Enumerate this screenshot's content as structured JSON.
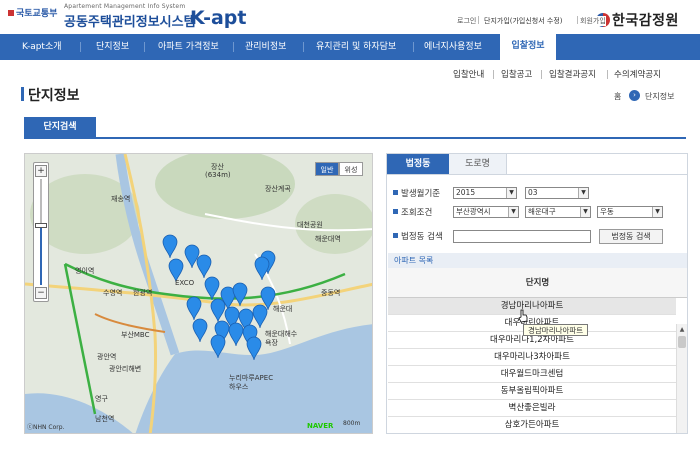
{
  "header": {
    "ministry": "국토교통부",
    "subtitle": "Apartement Management Info System",
    "title": "공동주택관리정보시스템",
    "brand": "K-apt",
    "util_links": [
      "로그인",
      "단지가입(가입신청서 수정)",
      "회원가입"
    ],
    "agency": "한국감정원"
  },
  "gnb": {
    "items": [
      "K-apt소개",
      "단지정보",
      "아파트 가격정보",
      "관리비정보",
      "유지관리 및 하자담보",
      "에너지사용정보"
    ],
    "active": "입찰정보"
  },
  "subnav": [
    "입찰안내",
    "입찰공고",
    "입찰결과공지",
    "수의계약공지"
  ],
  "page": {
    "title": "단지정보",
    "breadcrumb_home": "홈",
    "breadcrumb_current": "단지정보",
    "tab": "단지검색"
  },
  "map": {
    "toggle": [
      "일반",
      "위성"
    ],
    "labels": [
      "장산",
      "(634m)",
      "장산계곡",
      "재송역",
      "대천공원",
      "해운대역",
      "영이역",
      "수영역",
      "한광역",
      "EXCO",
      "중동역",
      "부산MBC",
      "해운대해수욕장",
      "누리마루APEC하우스",
      "광안역",
      "광안리해변",
      "남천역",
      "영구",
      "해운대"
    ],
    "naver": "NAVER",
    "scale": "800m",
    "copyright": "ⓒNHN Corp."
  },
  "panel": {
    "tabs": [
      "법정동",
      "도로명"
    ],
    "active_tab": "법정동",
    "filters": {
      "period_label": "발생월기준",
      "year": "2015",
      "month": "03",
      "condition_label": "조회조건",
      "city": "부산광역시",
      "district": "해운대구",
      "dong": "우동",
      "search_label": "법정동 검색",
      "search_value": "",
      "search_button": "법정동 검색"
    },
    "list_title": "아파트 목록",
    "column": "단지명",
    "rows": [
      "경남마리나아파트",
      "대우마린아파트",
      "대우마리나1,2차아파트",
      "대우마리나3차아파트",
      "대우월드마크센텀",
      "동부올림픽아파트",
      "벽산좋은빌라",
      "삼호가든아파트"
    ],
    "tooltip": "경남마리나아파트"
  },
  "colors": {
    "primary": "#2f67b5",
    "marker": "#2a8be8"
  }
}
